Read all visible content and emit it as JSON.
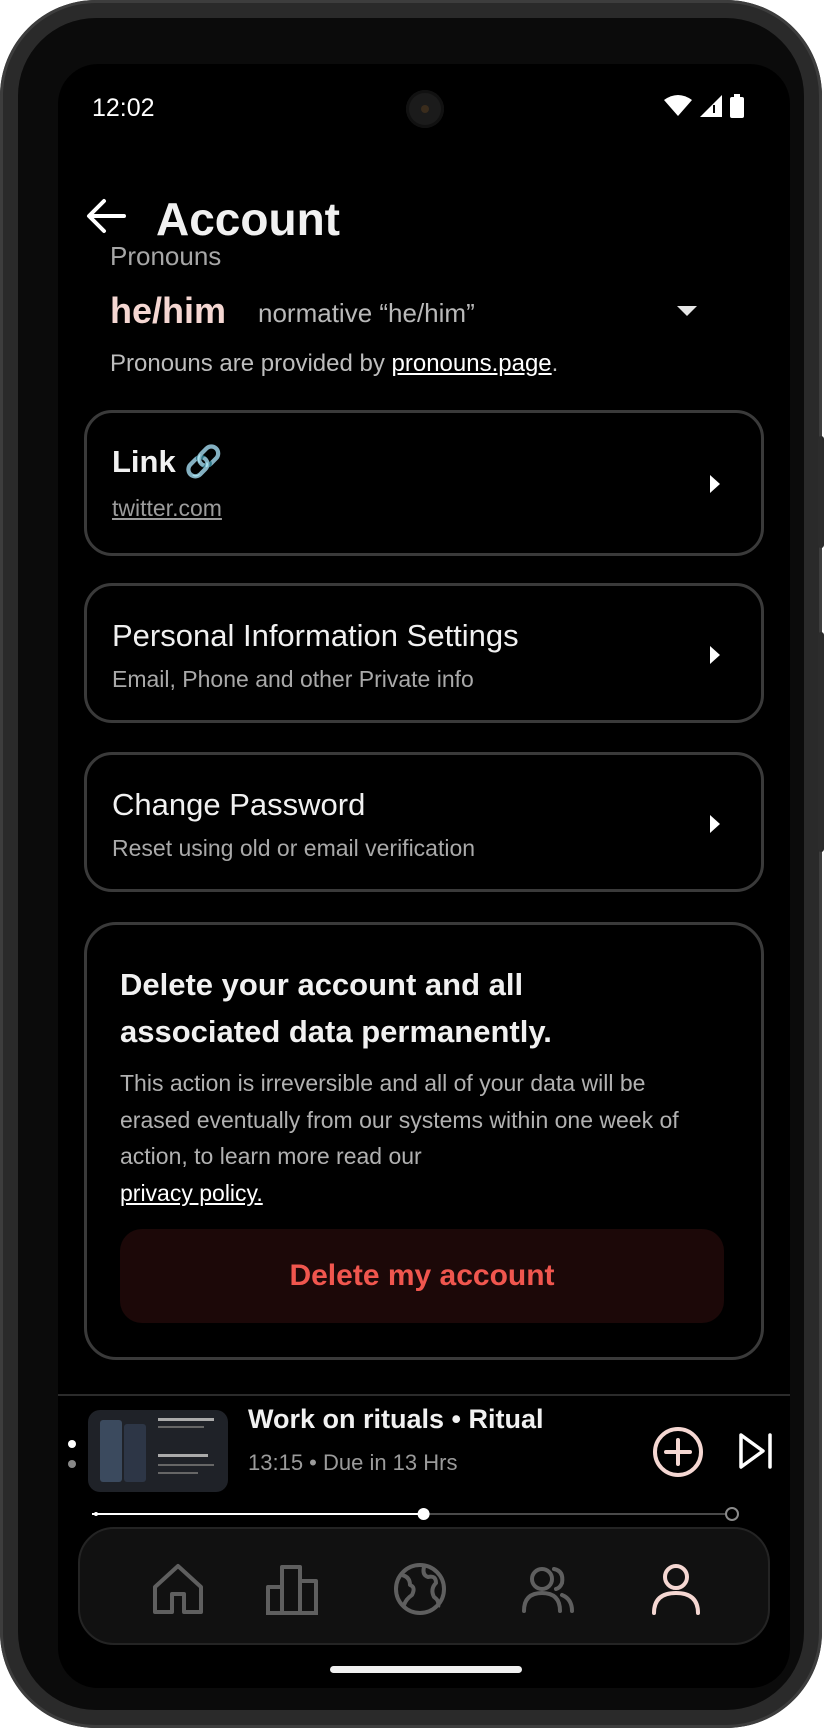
{
  "status_bar": {
    "time": "12:02",
    "icons": [
      "wifi-icon",
      "signal-icon",
      "battery-icon"
    ]
  },
  "header": {
    "title": "Account",
    "back_icon": "arrow-left-icon"
  },
  "pronouns": {
    "label": "Pronouns",
    "value": "he/him",
    "description": "normative “he/him”",
    "note_prefix": "Pronouns are provided by ",
    "note_link": "pronouns.page",
    "note_suffix": "."
  },
  "cards": [
    {
      "title": "Link 🔗",
      "subtitle": "twitter.com"
    },
    {
      "title": "Personal Information Settings",
      "subtitle": "Email, Phone and other Private info"
    },
    {
      "title": "Change Password",
      "subtitle": "Reset using old or email verification"
    }
  ],
  "danger": {
    "title": "Delete your account and all associated data permanently.",
    "body": "This action is irreversible and all of your data will be erased eventually from our systems within one week of action, to learn more read our",
    "link": "privacy policy.",
    "button": "Delete my account"
  },
  "now_playing": {
    "title": "Work on rituals • Ritual",
    "subtitle": "13:15 • Due in 13 Hrs",
    "progress": 0.52
  },
  "nav": {
    "items": [
      "home-icon",
      "stats-icon",
      "globe-icon",
      "community-icon",
      "profile-icon"
    ],
    "active": "profile-icon"
  },
  "colors": {
    "accent": "#f5d7d2",
    "danger_text": "#f0564e",
    "danger_bg": "#1c0808",
    "background": "#000000"
  }
}
